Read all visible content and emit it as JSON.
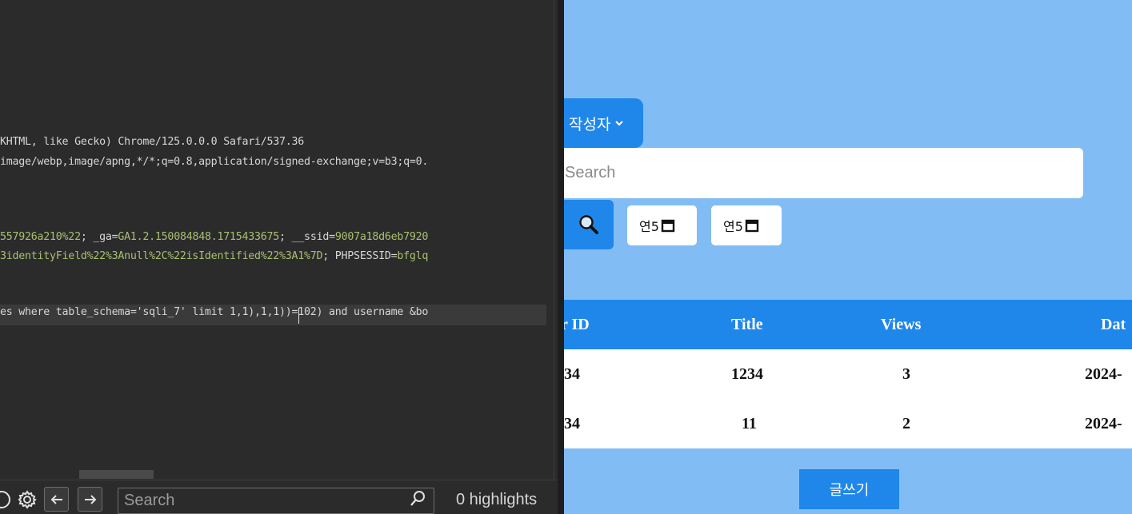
{
  "editor": {
    "lines": [
      {
        "parts": [
          {
            "t": "KHTML, like Gecko) Chrome/125.0.0.0 Safari/537.36",
            "c": "hl"
          }
        ]
      },
      {
        "parts": [
          {
            "t": "image/webp,image/apng,*/*;q=0.8,application/signed-exchange;v=b3;q=0.",
            "c": "hl"
          }
        ]
      },
      {
        "parts": [
          {
            "t": "557926a210%22",
            "c": "g"
          },
          {
            "t": "; ",
            "c": "hl"
          },
          {
            "t": "_ga",
            "c": "hl"
          },
          {
            "t": "=",
            "c": "hl"
          },
          {
            "t": "GA1.2.150084848.1715433675",
            "c": "g"
          },
          {
            "t": "; ",
            "c": "hl"
          },
          {
            "t": "__ssid",
            "c": "hl"
          },
          {
            "t": "=",
            "c": "hl"
          },
          {
            "t": "9007a18d6eb7920",
            "c": "g"
          }
        ]
      },
      {
        "parts": [
          {
            "t": "3identityField%22%3Anull%2C%22isIdentified%22%3A1%7D",
            "c": "g"
          },
          {
            "t": "; PHPSESSID=",
            "c": "hl"
          },
          {
            "t": "bfglq",
            "c": "g"
          }
        ]
      },
      {
        "parts": [
          {
            "t": "es where table_schema='sqli_7' limit 1,1),1,1))=102) and username &bo",
            "c": "hl"
          }
        ]
      }
    ]
  },
  "searchbar": {
    "placeholder": "Search",
    "highlights": "0 highlights",
    "icons": [
      "help-icon",
      "gear-icon",
      "arrow-left-icon",
      "arrow-right-icon",
      "magnifier-icon"
    ]
  },
  "web": {
    "filter_label": "작성자",
    "search_placeholder": "Search",
    "date1": "연5",
    "date2": "연5",
    "table": {
      "headers": [
        "r ID",
        "Title",
        "Views",
        "Dat"
      ],
      "rows": [
        [
          "34",
          "1234",
          "3",
          "2024-"
        ],
        [
          "34",
          "11",
          "2",
          "2024-"
        ]
      ]
    },
    "write_label": "글쓰기"
  },
  "colors": {
    "accent": "#1f87ea",
    "page_bg": "#82bcf4",
    "editor_bg": "#2b2b2b",
    "value_green": "#a8c070"
  }
}
